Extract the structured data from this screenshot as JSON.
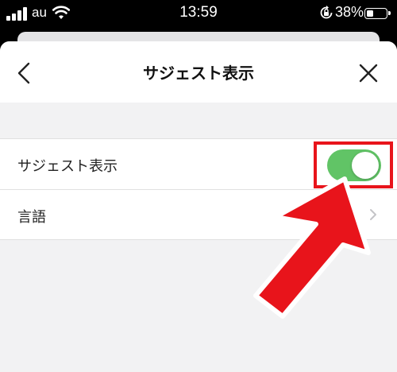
{
  "status_bar": {
    "carrier": "au",
    "time": "13:59",
    "battery_percent": "38%",
    "battery_level": 0.38,
    "icons": [
      "signal-icon",
      "wifi-icon",
      "rotation-lock-icon",
      "battery-icon"
    ]
  },
  "nav": {
    "title": "サジェスト表示",
    "back_icon": "chevron-left-icon",
    "close_icon": "close-icon"
  },
  "settings": {
    "rows": [
      {
        "label": "サジェスト表示",
        "control": "toggle",
        "enabled": true
      },
      {
        "label": "言語",
        "control": "disclosure"
      }
    ]
  },
  "colors": {
    "toggle_on": "#61c466",
    "annotation_red": "#e8141b",
    "background": "#f2f2f3"
  },
  "annotation": {
    "type": "red-arrow-and-box",
    "target": "suggest-toggle"
  }
}
